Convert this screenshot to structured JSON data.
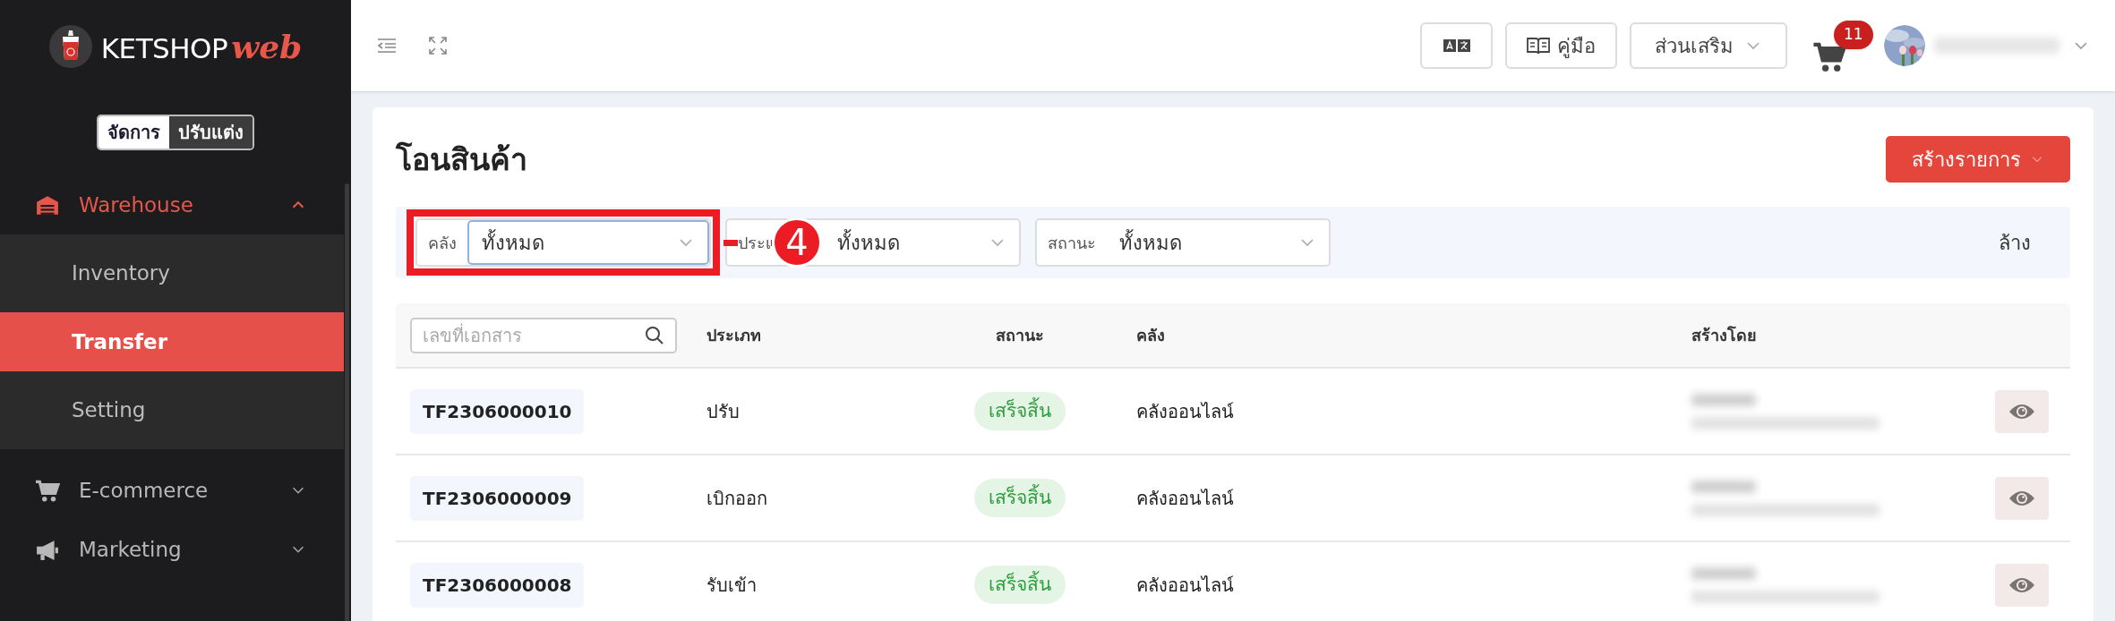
{
  "brand": {
    "name": "KETSHOP",
    "suffix": "web"
  },
  "mode_toggle": [
    {
      "label": "จัดการ",
      "selected": true
    },
    {
      "label": "ปรับแต่ง",
      "selected": false
    }
  ],
  "sidebar": {
    "items": [
      {
        "label": "Warehouse",
        "expanded": true,
        "children": [
          {
            "label": "Inventory",
            "selected": false
          },
          {
            "label": "Transfer",
            "selected": true
          },
          {
            "label": "Setting",
            "selected": false
          }
        ]
      },
      {
        "label": "E-commerce",
        "expanded": false
      },
      {
        "label": "Marketing",
        "expanded": false
      }
    ]
  },
  "header": {
    "manual_button": "คู่มือ",
    "addons_button": "ส่วนเสริม",
    "cart_count": "11"
  },
  "page": {
    "title": "โอนสินค้า",
    "create_button": "สร้างรายการ",
    "filters": [
      {
        "label": "คลัง",
        "value": "ทั้งหมด",
        "highlighted": true
      },
      {
        "label": "ประเ",
        "value": "ทั้งหมด",
        "highlighted": false
      },
      {
        "label": "สถานะ",
        "value": "ทั้งหมด",
        "highlighted": false
      }
    ],
    "annotation": "4",
    "clear_button": "ล้าง",
    "table": {
      "search_placeholder": "เลขที่เอกสาร",
      "columns": [
        "ประเภท",
        "สถานะ",
        "คลัง",
        "สร้างโดย"
      ],
      "rows": [
        {
          "doc_no": "TF2306000010",
          "type": "ปรับ",
          "status": "เสร็จสิ้น",
          "warehouse": "คลังออนไลน์"
        },
        {
          "doc_no": "TF2306000009",
          "type": "เบิกออก",
          "status": "เสร็จสิ้น",
          "warehouse": "คลังออนไลน์"
        },
        {
          "doc_no": "TF2306000008",
          "type": "รับเข้า",
          "status": "เสร็จสิ้น",
          "warehouse": "คลังออนไลน์"
        }
      ]
    }
  }
}
